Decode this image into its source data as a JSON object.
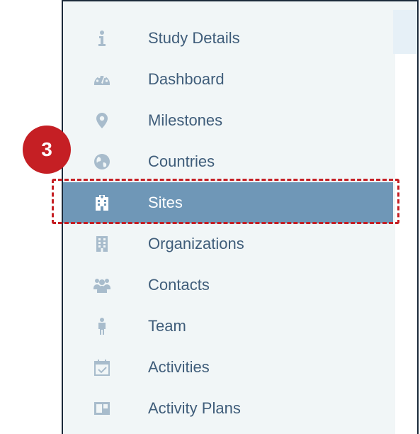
{
  "nav": {
    "items": [
      {
        "label": "Study Details",
        "icon": "info-icon"
      },
      {
        "label": "Dashboard",
        "icon": "dashboard-gauge-icon"
      },
      {
        "label": "Milestones",
        "icon": "map-marker-icon"
      },
      {
        "label": "Countries",
        "icon": "globe-icon"
      },
      {
        "label": "Sites",
        "icon": "hospital-building-icon",
        "active": true
      },
      {
        "label": "Organizations",
        "icon": "office-building-icon"
      },
      {
        "label": "Contacts",
        "icon": "users-group-icon"
      },
      {
        "label": "Team",
        "icon": "person-icon"
      },
      {
        "label": "Activities",
        "icon": "calendar-check-icon"
      },
      {
        "label": "Activity Plans",
        "icon": "board-icon"
      }
    ]
  },
  "callout": {
    "step_number": "3"
  },
  "colors": {
    "icon": "#a8bccc",
    "active_bg": "#6f97b7",
    "text": "#3f5d7a",
    "callout_red": "#c51f24",
    "panel_bg": "#f1f6f7"
  }
}
